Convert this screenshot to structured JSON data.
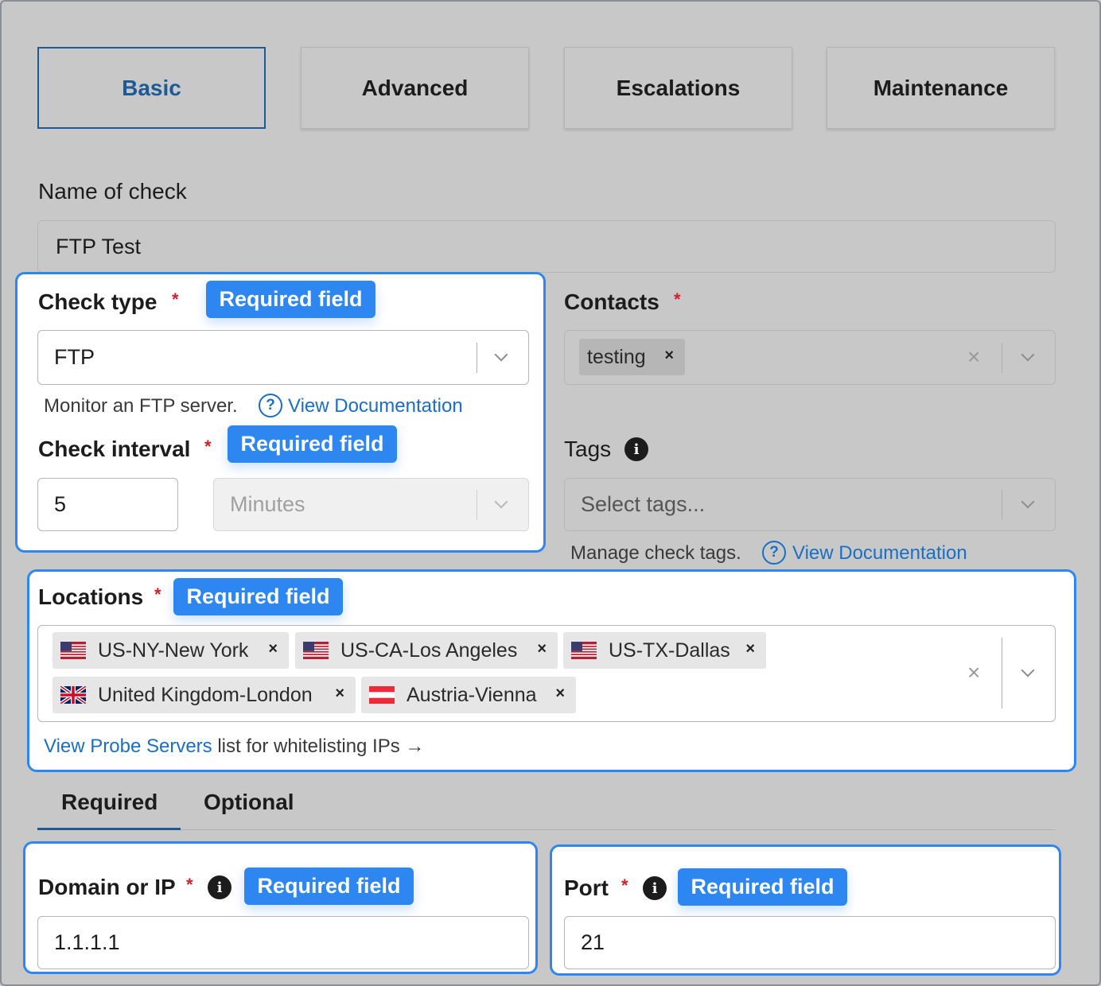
{
  "tabs": [
    {
      "label": "Basic",
      "active": true
    },
    {
      "label": "Advanced",
      "active": false
    },
    {
      "label": "Escalations",
      "active": false
    },
    {
      "label": "Maintenance",
      "active": false
    }
  ],
  "name_field": {
    "label": "Name of check",
    "value": "FTP Test"
  },
  "required_badge": "Required field",
  "check_type": {
    "label": "Check type",
    "value": "FTP",
    "help": "Monitor an FTP server.",
    "doc_link": "View Documentation"
  },
  "check_interval": {
    "label": "Check interval",
    "value": "5",
    "unit": "Minutes"
  },
  "contacts": {
    "label": "Contacts",
    "chip": "testing"
  },
  "tags": {
    "label": "Tags",
    "placeholder": "Select tags...",
    "help": "Manage check tags.",
    "doc_link": "View Documentation"
  },
  "locations": {
    "label": "Locations",
    "items": [
      {
        "name": "US-NY-New York",
        "flag": "us-flag-icon"
      },
      {
        "name": "US-CA-Los Angeles",
        "flag": "us-flag-icon"
      },
      {
        "name": "US-TX-Dallas",
        "flag": "us-flag-icon"
      },
      {
        "name": "United Kingdom-London",
        "flag": "uk-flag-icon"
      },
      {
        "name": "Austria-Vienna",
        "flag": "austria-flag-icon"
      }
    ],
    "probe_link": "View Probe Servers",
    "probe_text": "list for whitelisting IPs →"
  },
  "sub_tabs": [
    {
      "label": "Required",
      "active": true
    },
    {
      "label": "Optional",
      "active": false
    }
  ],
  "domain": {
    "label": "Domain or IP",
    "value": "1.1.1.1"
  },
  "port": {
    "label": "Port",
    "value": "21"
  },
  "colors": {
    "accent": "#2e87f0",
    "link": "#1a6fc4",
    "required_star": "#d0202a",
    "active_tab": "#1e5a96"
  }
}
